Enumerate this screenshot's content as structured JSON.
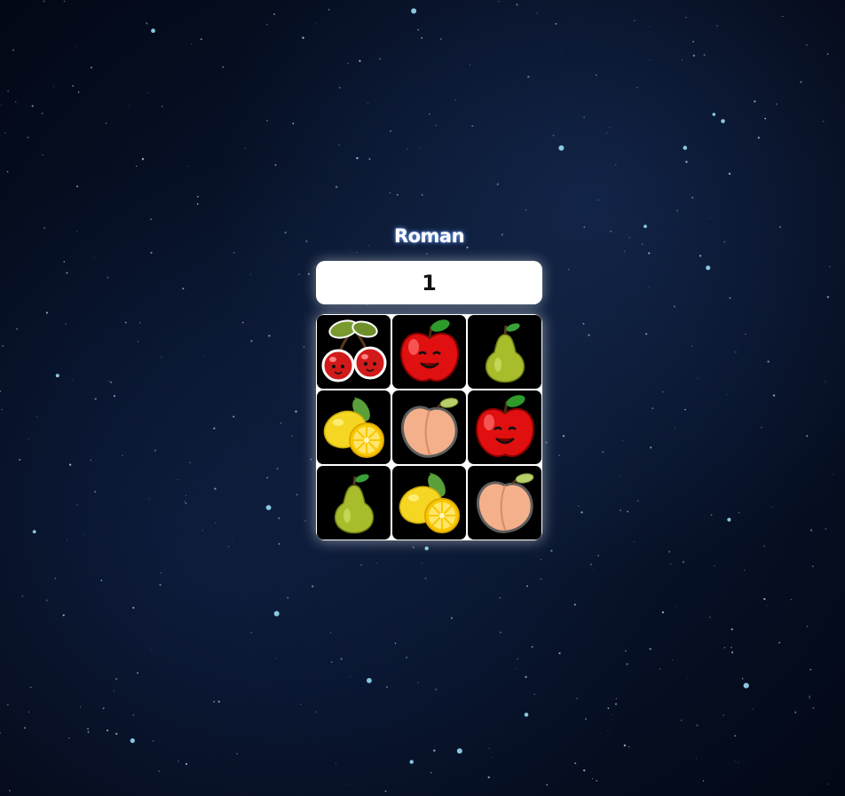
{
  "player": {
    "name": "Roman"
  },
  "score": {
    "value": "1"
  },
  "board": {
    "cells": [
      {
        "fruit": "cherry-icon"
      },
      {
        "fruit": "apple-icon"
      },
      {
        "fruit": "pear-icon"
      },
      {
        "fruit": "lemon-icon"
      },
      {
        "fruit": "peach-icon"
      },
      {
        "fruit": "apple-icon"
      },
      {
        "fruit": "pear-icon"
      },
      {
        "fruit": "lemon-icon"
      },
      {
        "fruit": "peach-icon"
      }
    ]
  },
  "colors": {
    "background": "#061025",
    "cell_background": "#000000",
    "frame": "#ffffff",
    "name_glow": "#7fa6ff"
  }
}
